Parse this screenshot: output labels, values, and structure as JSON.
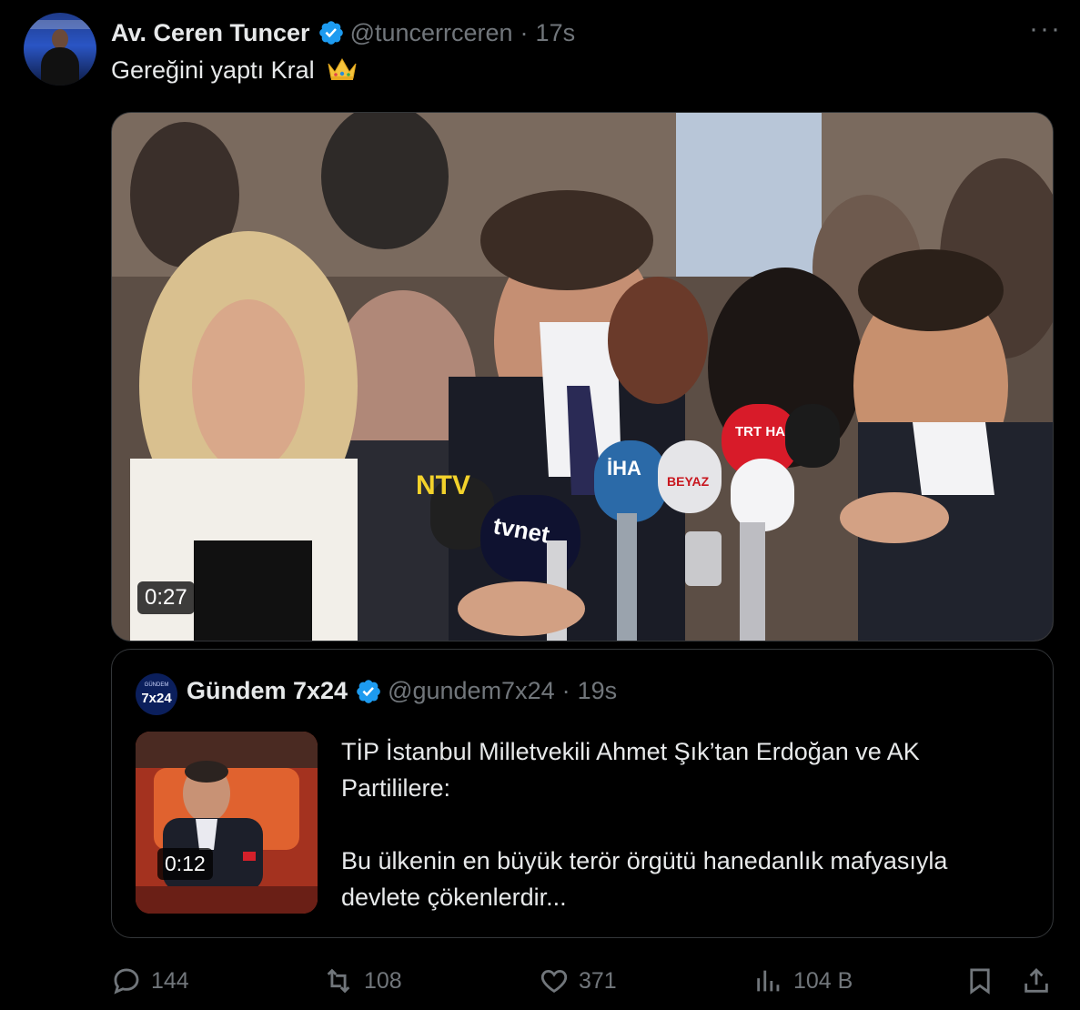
{
  "tweet": {
    "author_name": "Av. Ceren Tuncer",
    "handle": "@tuncerrceren",
    "separator": "·",
    "time": "17s",
    "more_label": "···",
    "text": "Gereğini yaptı Kral",
    "emoji": "crown-emoji",
    "media": {
      "duration": "0:27",
      "mic_labels": [
        "NTV",
        "tvnet",
        "İHA",
        "BEYAZ",
        "TRT HABER"
      ]
    }
  },
  "quote": {
    "avatar_top": "GÜNDEM",
    "avatar_main": "7x24",
    "author_name": "Gündem 7x24",
    "handle": "@gundem7x24",
    "separator": "·",
    "time": "19s",
    "thumb_duration": "0:12",
    "text_line1": "TİP İstanbul Milletvekili Ahmet Şık’tan Erdoğan ve AK Partililere:",
    "text_line2": "Bu ülkenin en büyük terör örgütü hanedanlık mafyasıyla devlete çökenlerdir..."
  },
  "actions": {
    "replies": "144",
    "reposts": "108",
    "likes": "371",
    "views": "104 B",
    "reply_icon": "reply-icon",
    "repost_icon": "repost-icon",
    "like_icon": "heart-icon",
    "views_icon": "views-icon",
    "bookmark_icon": "bookmark-icon",
    "share_icon": "share-icon"
  },
  "colors": {
    "background": "#000000",
    "primary_text": "#e7e9ea",
    "secondary_text": "#71767b",
    "border": "#333639",
    "verified": "#1d9bf0"
  }
}
